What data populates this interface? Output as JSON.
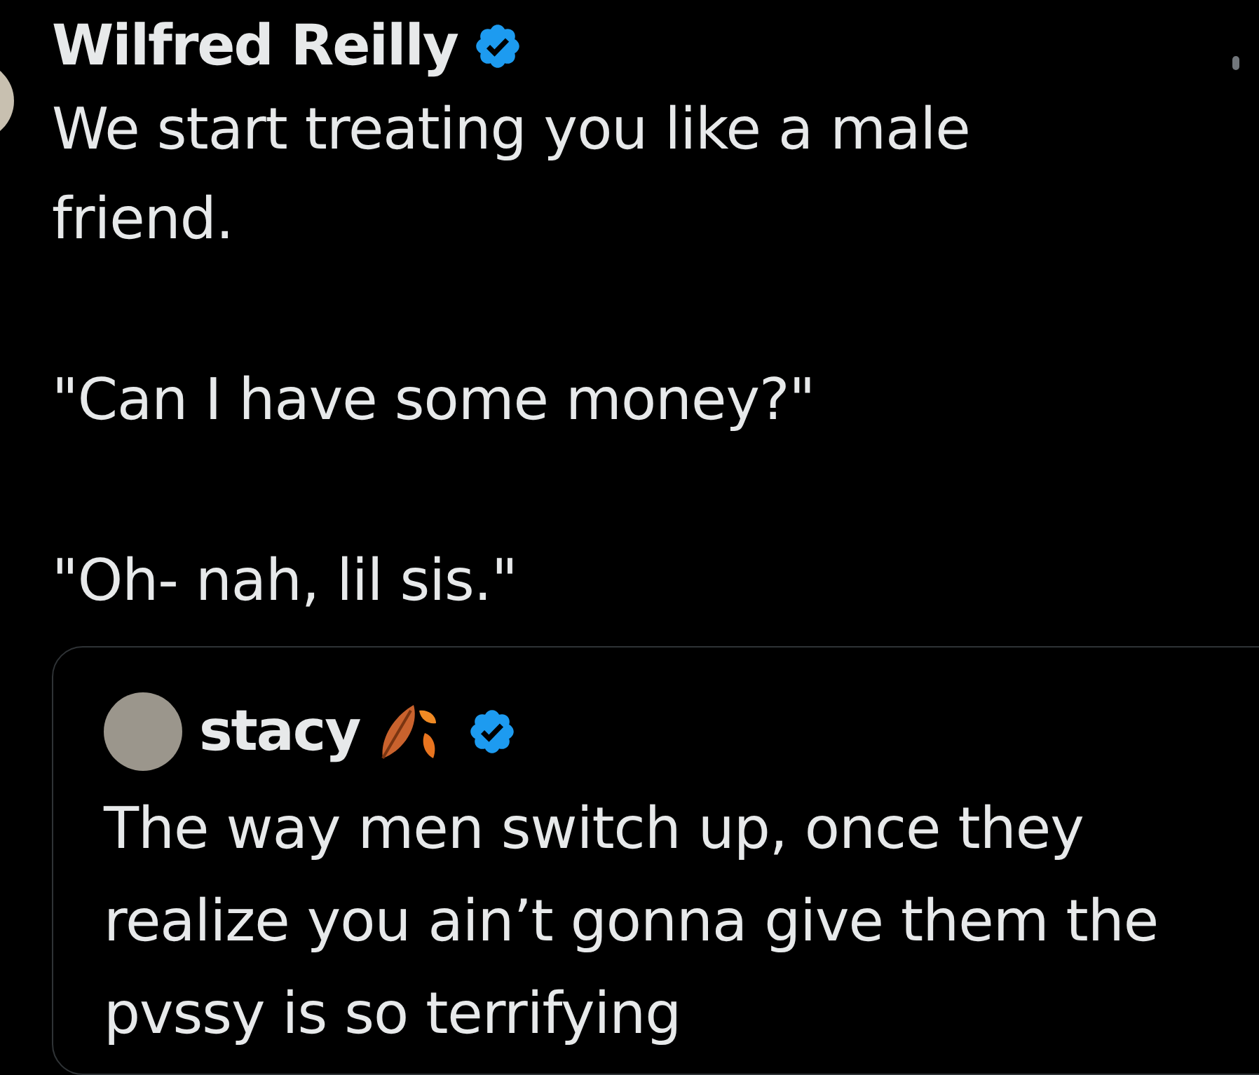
{
  "post": {
    "author": "Wilfred Reilly",
    "verified": true,
    "paragraphs": [
      "We start treating you like a male friend.",
      "\"Can I have some money?\"",
      "\"Oh- nah, lil sis.\""
    ],
    "quote": {
      "author": "stacy",
      "verified": true,
      "text": "The way men switch up, once they realize you ain’t gonna give them the pvssy is so terrifying"
    }
  }
}
